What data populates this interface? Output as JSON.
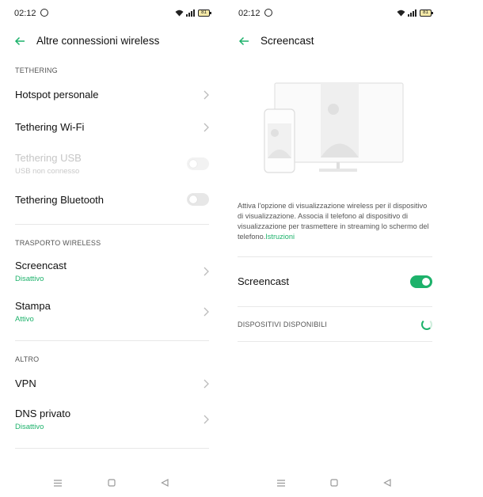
{
  "left": {
    "status": {
      "time": "02:12",
      "battery": "81"
    },
    "header": {
      "title": "Altre connessioni wireless"
    },
    "sections": {
      "tethering": "TETHERING",
      "wireless": "TRASPORTO WIRELESS",
      "altro": "ALTRO"
    },
    "rows": {
      "hotspot": {
        "label": "Hotspot personale"
      },
      "tether_wifi": {
        "label": "Tethering Wi-Fi"
      },
      "tether_usb": {
        "label": "Tethering USB",
        "sub": "USB non connesso"
      },
      "tether_bt": {
        "label": "Tethering Bluetooth"
      },
      "screencast": {
        "label": "Screencast",
        "sub": "Disattivo"
      },
      "stampa": {
        "label": "Stampa",
        "sub": "Attivo"
      },
      "vpn": {
        "label": "VPN"
      },
      "dns": {
        "label": "DNS privato",
        "sub": "Disattivo"
      }
    }
  },
  "right": {
    "status": {
      "time": "02:12",
      "battery": "81"
    },
    "header": {
      "title": "Screencast"
    },
    "description": "Attiva l'opzione di visualizzazione wireless per il dispositivo di visualizzazione. Associa il telefono al dispositivo di visualizzazione per trasmettere in streaming lo schermo del telefono.",
    "link": "Istruzioni",
    "toggle_label": "Screencast",
    "devices_section": "DISPOSITIVI DISPONIBILI"
  },
  "colors": {
    "accent": "#1db26b"
  },
  "icons": [
    "back-arrow-icon",
    "chevron-right-icon",
    "whatsapp-icon",
    "wifi-icon",
    "signal-icon",
    "battery-icon",
    "menu-icon",
    "home-icon",
    "back-icon"
  ]
}
